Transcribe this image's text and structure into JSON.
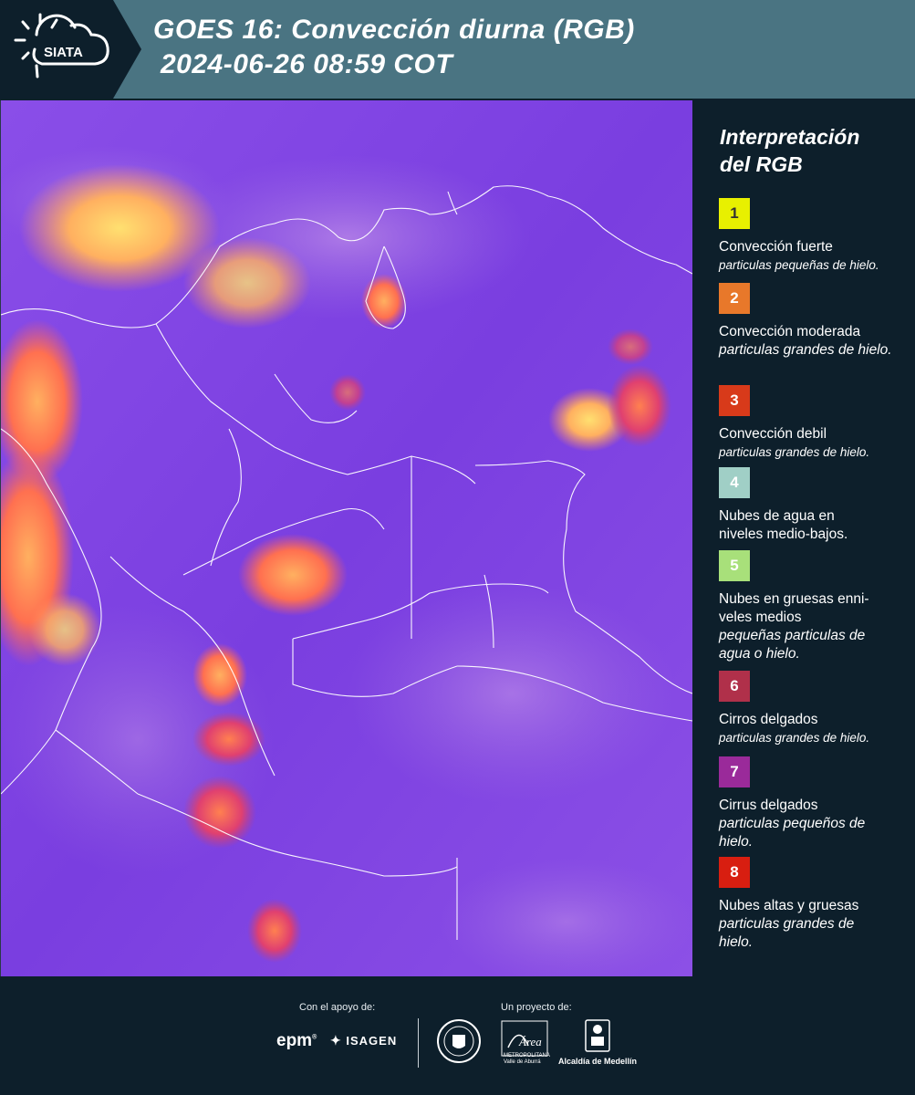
{
  "header": {
    "logo_text": "SIATA",
    "title_line1": "GOES 16: Convección diurna (RGB)",
    "title_line2": "2024-06-26 08:59 COT",
    "background_color": "#4a7482"
  },
  "map": {
    "description_icon": "satellite-rgb-map",
    "background_color": "#7a3ee0"
  },
  "legend": {
    "title_line1": "Interpretación",
    "title_line2": "del RGB",
    "items": [
      {
        "number": "1",
        "color": "#e8f000",
        "label": "Convección fuerte",
        "sub": "particulas pequeñas de hielo."
      },
      {
        "number": "2",
        "color": "#e8782a",
        "label": "Convección moderada",
        "sub": "particulas grandes de hielo."
      },
      {
        "number": "3",
        "color": "#d83a1a",
        "label": "Convección debil",
        "sub": "particulas grandes de hielo."
      },
      {
        "number": "4",
        "color": "#a0cfc6",
        "label": "Nubes de agua en niveles medio-bajos.",
        "sub": ""
      },
      {
        "number": "5",
        "color": "#a8e07a",
        "label": "Nubes en gruesas enni-veles medios",
        "sub": "pequeñas particulas de agua o hielo."
      },
      {
        "number": "6",
        "color": "#b0304a",
        "label": "Cirros delgados",
        "sub": "particulas grandes de hielo."
      },
      {
        "number": "7",
        "color": "#9a2a9a",
        "label": "Cirrus delgados",
        "sub": "particulas pequeños de hielo."
      },
      {
        "number": "8",
        "color": "#d81e10",
        "label": "Nubes altas y gruesas",
        "sub": "particulas grandes de hielo."
      }
    ]
  },
  "footer": {
    "support_label": "Con el apoyo de:",
    "project_label": "Un proyecto de:",
    "epm": "epm",
    "isagen": "ISAGEN",
    "area_name": "Área",
    "area_sub1": "METROPOLITANA",
    "area_sub2": "Valle de Aburrá",
    "alcaldia": "Alcaldía de Medellín"
  }
}
